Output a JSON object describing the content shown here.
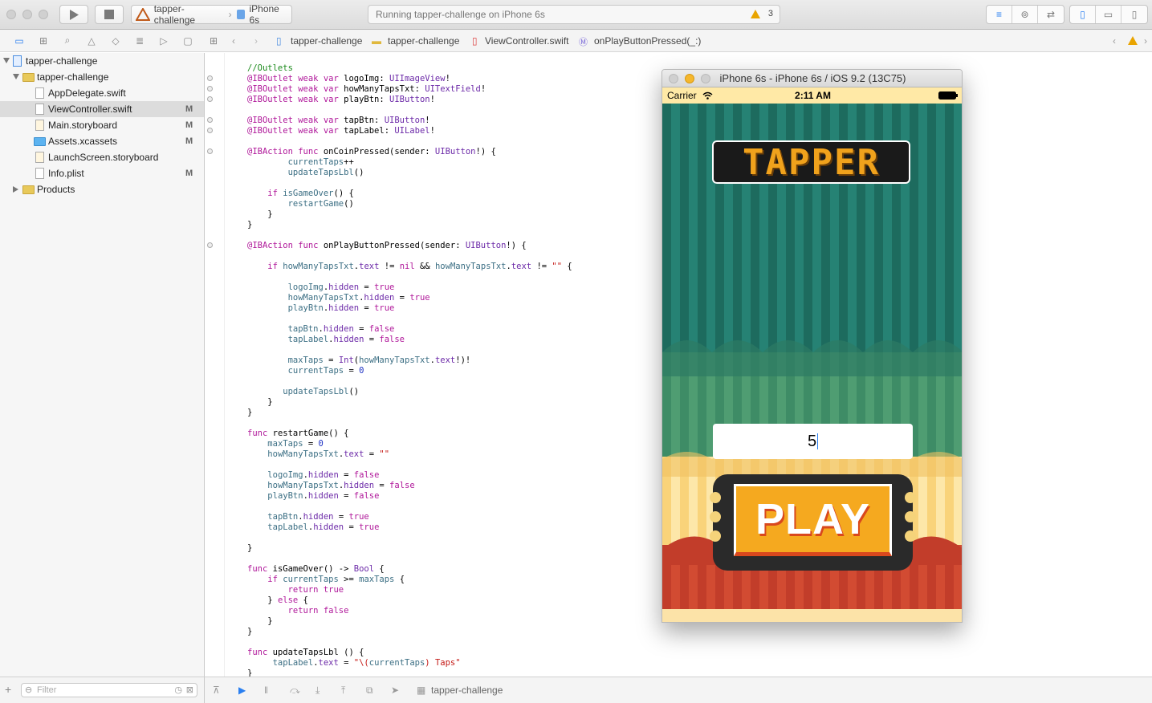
{
  "toolbar": {
    "scheme_project": "tapper-challenge",
    "scheme_device": "iPhone 6s",
    "activity_text": "Running tapper-challenge on iPhone 6s",
    "warning_count": "3"
  },
  "navigator": {
    "items": [
      {
        "label": "tapper-challenge",
        "badge": ""
      },
      {
        "label": "tapper-challenge",
        "badge": ""
      },
      {
        "label": "AppDelegate.swift",
        "badge": ""
      },
      {
        "label": "ViewController.swift",
        "badge": "M"
      },
      {
        "label": "Main.storyboard",
        "badge": "M"
      },
      {
        "label": "Assets.xcassets",
        "badge": "M"
      },
      {
        "label": "LaunchScreen.storyboard",
        "badge": ""
      },
      {
        "label": "Info.plist",
        "badge": "M"
      },
      {
        "label": "Products",
        "badge": ""
      }
    ],
    "filter_placeholder": "Filter"
  },
  "jumpbar": {
    "crumbs": [
      "tapper-challenge",
      "tapper-challenge",
      "ViewController.swift",
      "onPlayButtonPressed(_:)"
    ]
  },
  "debug": {
    "target": "tapper-challenge"
  },
  "simulator": {
    "title": "iPhone 6s - iPhone 6s / iOS 9.2 (13C75)",
    "carrier": "Carrier",
    "time": "2:11 AM",
    "logo_text": "TAPPER",
    "taps_input_value": "5",
    "play_label": "PLAY"
  },
  "colors": {
    "accent": "#2a7ff0",
    "keyword": "#b0189a",
    "comment": "#1b8a1b",
    "string": "#c41a16",
    "warning": "#e9a400"
  }
}
